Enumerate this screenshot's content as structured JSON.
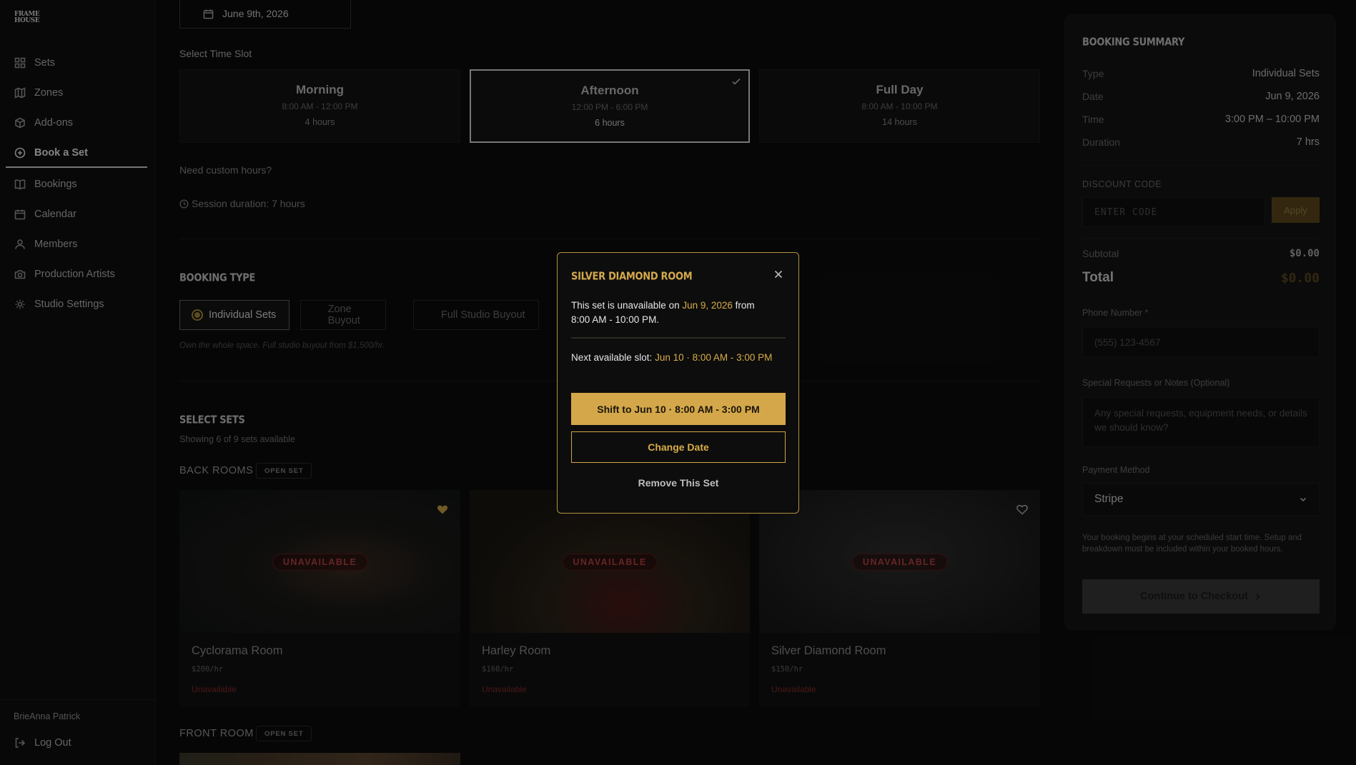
{
  "sidebar": {
    "logo": "FRAME HOUSE",
    "items": [
      {
        "label": "Sets",
        "icon": "grid-icon"
      },
      {
        "label": "Zones",
        "icon": "map-icon"
      },
      {
        "label": "Add-ons",
        "icon": "package-icon"
      },
      {
        "label": "Book a Set",
        "icon": "plus-circle-icon"
      },
      {
        "label": "Bookings",
        "icon": "book-icon"
      },
      {
        "label": "Calendar",
        "icon": "calendar-icon"
      },
      {
        "label": "Members",
        "icon": "user-icon"
      },
      {
        "label": "Production Artists",
        "icon": "camera-icon"
      },
      {
        "label": "Studio Settings",
        "icon": "gear-icon"
      }
    ],
    "user_name": "BrieAnna Patrick",
    "logout_label": "Log Out"
  },
  "booking": {
    "date": "June 9th, 2026",
    "time_slot_label": "Select Time Slot",
    "slots": [
      {
        "title": "Morning",
        "time": "8:00 AM - 12:00 PM",
        "hours": "4 hours"
      },
      {
        "title": "Afternoon",
        "time": "12:00 PM - 6:00 PM",
        "hours": "6 hours"
      },
      {
        "title": "Full Day",
        "time": "8:00 AM - 10:00 PM",
        "hours": "14 hours"
      }
    ],
    "custom_hours": "Need custom hours?",
    "session_duration": "Session duration: 7 hours",
    "booking_type_head": "BOOKING TYPE",
    "types": [
      "Individual Sets",
      "Zone Buyout",
      "Full Studio Buyout"
    ],
    "type_hint": "Own the whole space. Full studio buyout from $1,500/hr.",
    "select_sets_head": "SELECT SETS",
    "showing": "Showing 6 of 9 sets available",
    "groups": [
      {
        "title": "BACK ROOMS",
        "pill": "OPEN SET"
      },
      {
        "title": "FRONT ROOM",
        "pill": "OPEN SET"
      }
    ],
    "cards": [
      {
        "name": "Cyclorama Room",
        "rate": "$200/hr",
        "status": "Unavailable",
        "badge": "UNAVAILABLE"
      },
      {
        "name": "Harley Room",
        "rate": "$160/hr",
        "status": "Unavailable",
        "badge": "UNAVAILABLE"
      },
      {
        "name": "Silver Diamond Room",
        "rate": "$150/hr",
        "status": "Unavailable",
        "badge": "UNAVAILABLE"
      }
    ]
  },
  "summary": {
    "title": "BOOKING SUMMARY",
    "rows": [
      {
        "k": "Type",
        "v": "Individual Sets"
      },
      {
        "k": "Date",
        "v": "Jun 9, 2026"
      },
      {
        "k": "Time",
        "v": "3:00 PM – 10:00 PM"
      },
      {
        "k": "Duration",
        "v": "7 hrs"
      }
    ],
    "discount_label": "DISCOUNT CODE",
    "discount_placeholder": "ENTER CODE",
    "apply_label": "Apply",
    "subtotal_label": "Subtotal",
    "subtotal": "$0.00",
    "total_label": "Total",
    "total": "$0.00",
    "phone_label": "Phone Number *",
    "phone_placeholder": "(555) 123-4567",
    "notes_label": "Special Requests or Notes (Optional)",
    "notes_placeholder": "Any special requests, equipment needs, or details we should know?",
    "payment_label": "Payment Method",
    "payment_value": "Stripe",
    "note": "Your booking begins at your scheduled start time. Setup and breakdown must be included within your booked hours.",
    "checkout_label": "Continue to Checkout"
  },
  "modal": {
    "title": "SILVER DIAMOND ROOM",
    "line1_a": "This set is unavailable on ",
    "line1_date": "Jun 9, 2026",
    "line1_b": " from",
    "line1_c": "8:00 AM - 10:00 PM.",
    "next_label": "Next available slot: ",
    "next_slot": "Jun 10 · 8:00 AM - 3:00 PM",
    "shift_label": "Shift to Jun 10 · 8:00 AM - 3:00 PM",
    "change_date_label": "Change Date",
    "remove_label": "Remove This Set"
  },
  "colors": {
    "accent": "#d4a84a",
    "unavailable": "#b84444"
  }
}
